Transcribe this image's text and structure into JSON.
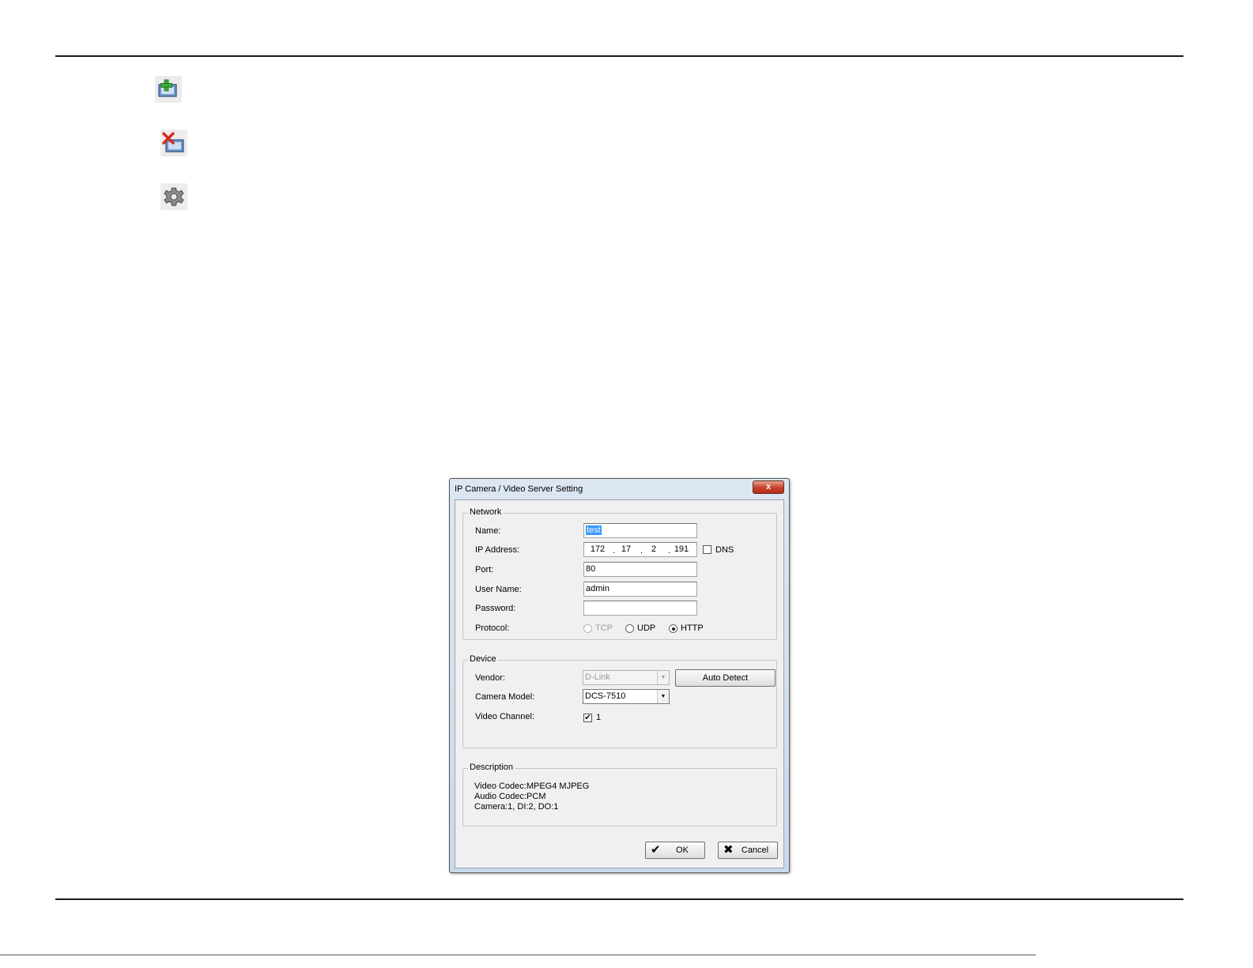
{
  "toolbar_icons": [
    {
      "name": "add-camera-icon"
    },
    {
      "name": "remove-camera-icon"
    },
    {
      "name": "settings-icon"
    }
  ],
  "dialog": {
    "title": "IP Camera / Video Server Setting",
    "close_label": "x",
    "network": {
      "legend": "Network",
      "name_label": "Name:",
      "name_value": "test",
      "ip_label": "IP Address:",
      "ip_octets": [
        "172",
        "17",
        "2",
        "191"
      ],
      "dns_label": "DNS",
      "port_label": "Port:",
      "port_value": "80",
      "username_label": "User Name:",
      "username_value": "admin",
      "password_label": "Password:",
      "password_value": "",
      "protocol_label": "Protocol:",
      "protocol_options": [
        "TCP",
        "UDP",
        "HTTP"
      ],
      "protocol_selected": "HTTP"
    },
    "device": {
      "legend": "Device",
      "vendor_label": "Vendor:",
      "vendor_value": "D-Link",
      "auto_detect_label": "Auto Detect",
      "model_label": "Camera Model:",
      "model_value": "DCS-7510",
      "channel_label": "Video Channel:",
      "channel_value": "1",
      "channel_checked": true
    },
    "description": {
      "legend": "Description",
      "lines": [
        "Video Codec:MPEG4 MJPEG",
        "Audio Codec:PCM",
        "Camera:1, DI:2, DO:1"
      ]
    },
    "ok_label": "OK",
    "cancel_label": "Cancel"
  }
}
